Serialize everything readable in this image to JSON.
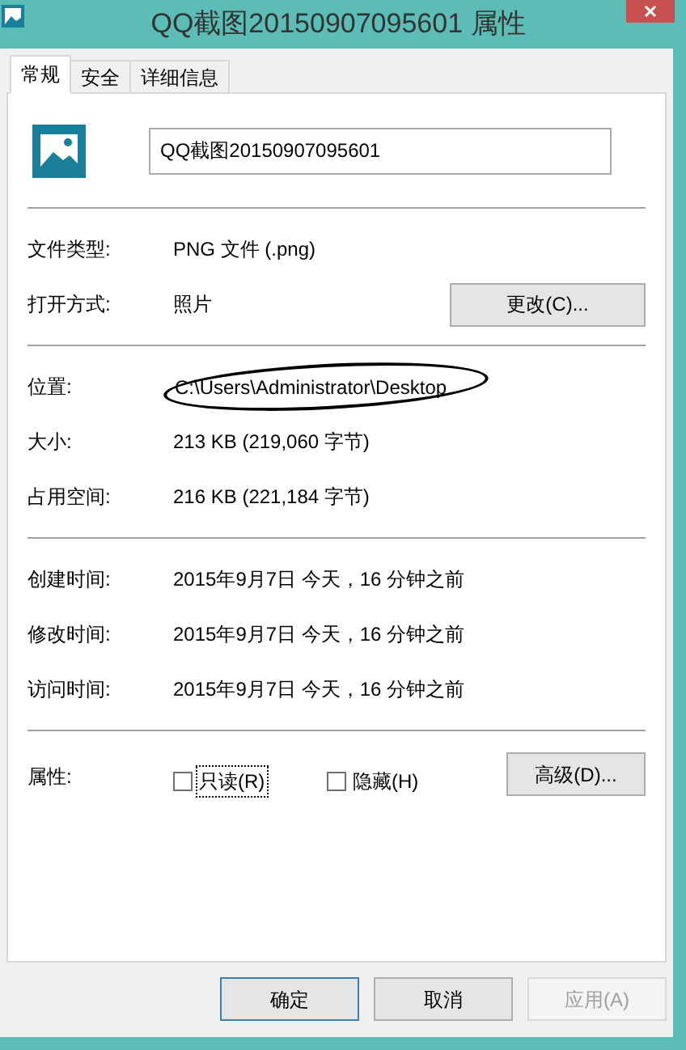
{
  "window": {
    "title": "QQ截图20150907095601 属性"
  },
  "tabs": [
    {
      "label": "常规",
      "selected": true
    },
    {
      "label": "安全",
      "selected": false
    },
    {
      "label": "详细信息",
      "selected": false
    }
  ],
  "file_name": "QQ截图20150907095601",
  "sections": [
    {
      "rows": [
        {
          "label": "文件类型:",
          "value": "PNG 文件 (.png)"
        },
        {
          "label": "打开方式:",
          "value": "照片",
          "button": "更改(C)..."
        }
      ]
    },
    {
      "rows": [
        {
          "label": "位置:",
          "value": "C:\\Users\\Administrator\\Desktop",
          "scribbled": true
        },
        {
          "label": "大小:",
          "value": "213 KB (219,060 字节)"
        },
        {
          "label": "占用空间:",
          "value": "216 KB (221,184 字节)"
        }
      ]
    },
    {
      "rows": [
        {
          "label": "创建时间:",
          "value": "2015年9月7日 今天，16 分钟之前"
        },
        {
          "label": "修改时间:",
          "value": "2015年9月7日 今天，16 分钟之前"
        },
        {
          "label": "访问时间:",
          "value": "2015年9月7日 今天，16 分钟之前"
        }
      ]
    }
  ],
  "attributes": {
    "label": "属性:",
    "options": [
      {
        "label": "只读(R)",
        "checked": false,
        "focused": true
      },
      {
        "label": "隐藏(H)",
        "checked": false,
        "focused": false
      }
    ],
    "button": "高级(D)..."
  },
  "buttons": [
    {
      "label": "确定",
      "default": true,
      "disabled": false
    },
    {
      "label": "取消",
      "default": false,
      "disabled": false
    },
    {
      "label": "应用(A)",
      "default": false,
      "disabled": true
    }
  ]
}
